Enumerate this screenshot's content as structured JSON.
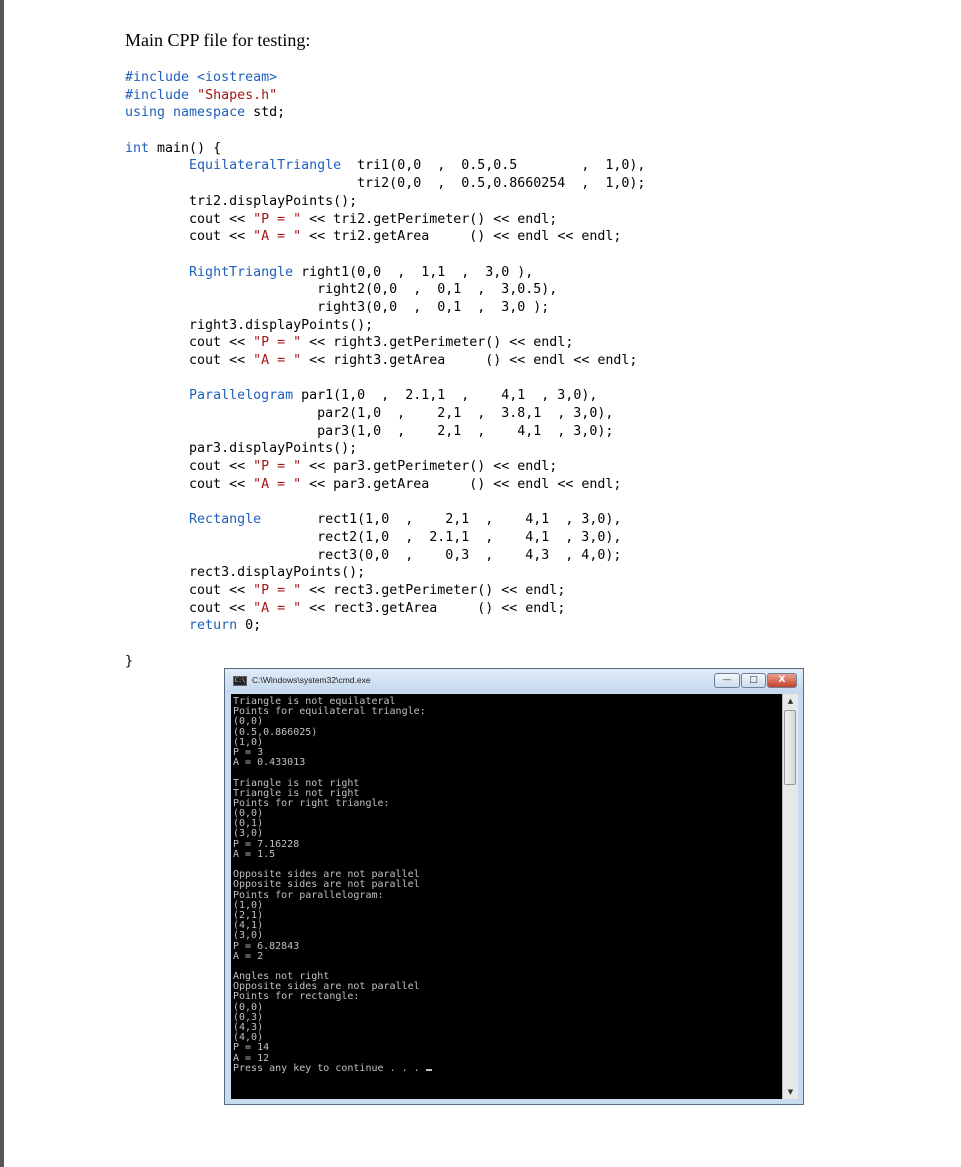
{
  "document": {
    "title": "Main CPP file for testing:",
    "code_lines": [
      [
        {
          "t": "#include <iostream>",
          "c": "k"
        }
      ],
      [
        {
          "t": "#include ",
          "c": "k"
        },
        {
          "t": "\"Shapes.h\"",
          "c": "s"
        }
      ],
      [
        {
          "t": "using namespace",
          "c": "k"
        },
        {
          "t": " std;",
          "c": ""
        }
      ],
      [
        {
          "t": "",
          "c": ""
        }
      ],
      [
        {
          "t": "int",
          "c": "k"
        },
        {
          "t": " main() {",
          "c": ""
        }
      ],
      [
        {
          "t": "        ",
          "c": ""
        },
        {
          "t": "EquilateralTriangle",
          "c": "k"
        },
        {
          "t": "  tri1(0,0  ,  0.5,0.5        ,  1,0),",
          "c": ""
        }
      ],
      [
        {
          "t": "                             tri2(0,0  ,  0.5,0.8660254  ,  1,0);",
          "c": ""
        }
      ],
      [
        {
          "t": "        tri2.displayPoints();",
          "c": ""
        }
      ],
      [
        {
          "t": "        cout << ",
          "c": ""
        },
        {
          "t": "\"P = \"",
          "c": "s"
        },
        {
          "t": " << tri2.getPerimeter() << endl;",
          "c": ""
        }
      ],
      [
        {
          "t": "        cout << ",
          "c": ""
        },
        {
          "t": "\"A = \"",
          "c": "s"
        },
        {
          "t": " << tri2.getArea     () << endl << endl;",
          "c": ""
        }
      ],
      [
        {
          "t": "",
          "c": ""
        }
      ],
      [
        {
          "t": "        ",
          "c": ""
        },
        {
          "t": "RightTriangle",
          "c": "k"
        },
        {
          "t": " right1(0,0  ,  1,1  ,  3,0 ),",
          "c": ""
        }
      ],
      [
        {
          "t": "                        right2(0,0  ,  0,1  ,  3,0.5),",
          "c": ""
        }
      ],
      [
        {
          "t": "                        right3(0,0  ,  0,1  ,  3,0 );",
          "c": ""
        }
      ],
      [
        {
          "t": "        right3.displayPoints();",
          "c": ""
        }
      ],
      [
        {
          "t": "        cout << ",
          "c": ""
        },
        {
          "t": "\"P = \"",
          "c": "s"
        },
        {
          "t": " << right3.getPerimeter() << endl;",
          "c": ""
        }
      ],
      [
        {
          "t": "        cout << ",
          "c": ""
        },
        {
          "t": "\"A = \"",
          "c": "s"
        },
        {
          "t": " << right3.getArea     () << endl << endl;",
          "c": ""
        }
      ],
      [
        {
          "t": "",
          "c": ""
        }
      ],
      [
        {
          "t": "        ",
          "c": ""
        },
        {
          "t": "Parallelogram",
          "c": "k"
        },
        {
          "t": " par1(1,0  ,  2.1,1  ,    4,1  , 3,0),",
          "c": ""
        }
      ],
      [
        {
          "t": "                        par2(1,0  ,    2,1  ,  3.8,1  , 3,0),",
          "c": ""
        }
      ],
      [
        {
          "t": "                        par3(1,0  ,    2,1  ,    4,1  , 3,0);",
          "c": ""
        }
      ],
      [
        {
          "t": "        par3.displayPoints();",
          "c": ""
        }
      ],
      [
        {
          "t": "        cout << ",
          "c": ""
        },
        {
          "t": "\"P = \"",
          "c": "s"
        },
        {
          "t": " << par3.getPerimeter() << endl;",
          "c": ""
        }
      ],
      [
        {
          "t": "        cout << ",
          "c": ""
        },
        {
          "t": "\"A = \"",
          "c": "s"
        },
        {
          "t": " << par3.getArea     () << endl << endl;",
          "c": ""
        }
      ],
      [
        {
          "t": "",
          "c": ""
        }
      ],
      [
        {
          "t": "        ",
          "c": ""
        },
        {
          "t": "Rectangle",
          "c": "k"
        },
        {
          "t": "       rect1(1,0  ,    2,1  ,    4,1  , 3,0),",
          "c": ""
        }
      ],
      [
        {
          "t": "                        rect2(1,0  ,  2.1,1  ,    4,1  , 3,0),",
          "c": ""
        }
      ],
      [
        {
          "t": "                        rect3(0,0  ,    0,3  ,    4,3  , 4,0);",
          "c": ""
        }
      ],
      [
        {
          "t": "        rect3.displayPoints();",
          "c": ""
        }
      ],
      [
        {
          "t": "        cout << ",
          "c": ""
        },
        {
          "t": "\"P = \"",
          "c": "s"
        },
        {
          "t": " << rect3.getPerimeter() << endl;",
          "c": ""
        }
      ],
      [
        {
          "t": "        cout << ",
          "c": ""
        },
        {
          "t": "\"A = \"",
          "c": "s"
        },
        {
          "t": " << rect3.getArea     () << endl;",
          "c": ""
        }
      ],
      [
        {
          "t": "        ",
          "c": ""
        },
        {
          "t": "return",
          "c": "k"
        },
        {
          "t": " 0;",
          "c": ""
        }
      ],
      [
        {
          "t": "",
          "c": ""
        }
      ],
      [
        {
          "t": "}",
          "c": ""
        }
      ]
    ]
  },
  "console_window": {
    "title": "C:\\Windows\\system32\\cmd.exe",
    "buttons": {
      "minimize": "—",
      "maximize": "□",
      "close": "X"
    },
    "scroll": {
      "up": "▲",
      "down": "▼"
    },
    "output_lines": [
      "Triangle is not equilateral",
      "Points for equilateral triangle:",
      "(0,0)",
      "(0.5,0.866025)",
      "(1,0)",
      "P = 3",
      "A = 0.433013",
      "",
      "Triangle is not right",
      "Triangle is not right",
      "Points for right triangle:",
      "(0,0)",
      "(0,1)",
      "(3,0)",
      "P = 7.16228",
      "A = 1.5",
      "",
      "Opposite sides are not parallel",
      "Opposite sides are not parallel",
      "Points for parallelogram:",
      "(1,0)",
      "(2,1)",
      "(4,1)",
      "(3,0)",
      "P = 6.82843",
      "A = 2",
      "",
      "Angles not right",
      "Opposite sides are not parallel",
      "Points for rectangle:",
      "(0,0)",
      "(0,3)",
      "(4,3)",
      "(4,0)",
      "P = 14",
      "A = 12",
      "Press any key to continue . . . "
    ]
  },
  "colors": {
    "keyword": "#1f5fbf",
    "string": "#a31515",
    "console_bg": "#000000",
    "console_fg": "#c0c0c0"
  }
}
